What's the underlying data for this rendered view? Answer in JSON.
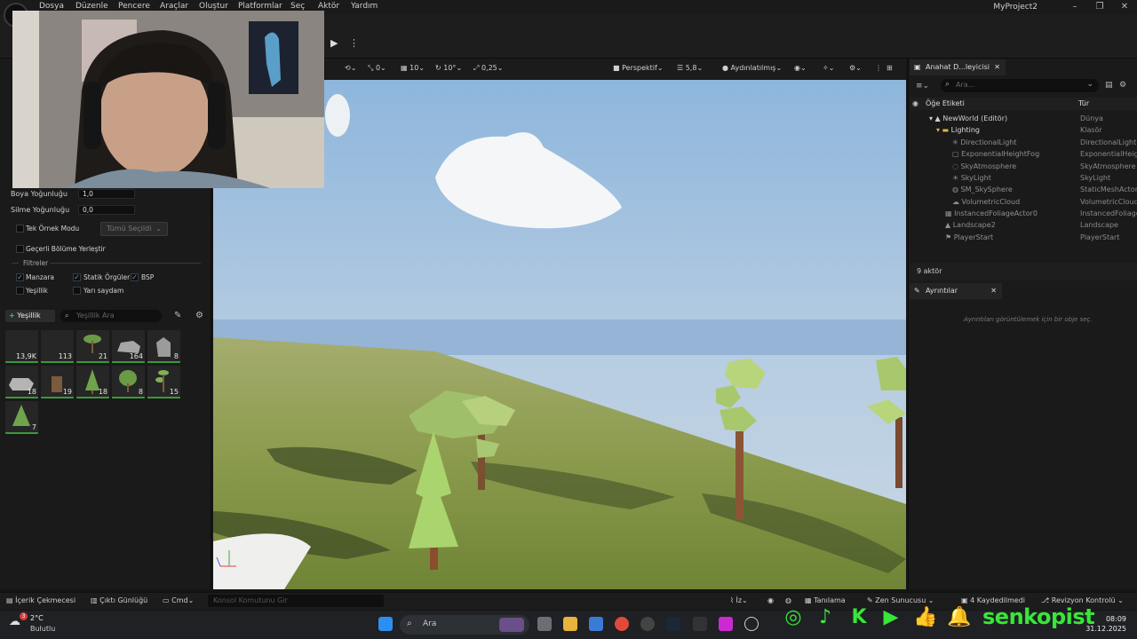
{
  "menubar": {
    "items": [
      "Dosya",
      "Düzenle",
      "Pencere",
      "Araçlar",
      "Oluştur",
      "Platformlar",
      "Seç",
      "Aktör",
      "Yardım"
    ],
    "project_title": "MyProject2"
  },
  "foliage_panel": {
    "paint_density_label": "Boya Yoğunluğu",
    "paint_density_value": "1,0",
    "erase_density_label": "Silme Yoğunluğu",
    "erase_density_value": "0,0",
    "single_instance_label": "Tek Örnek Modu",
    "single_instance_dropdown": "Tümü Seçildi",
    "place_current_level_label": "Geçerli Bölüme Yerleştir",
    "filters_header": "Filtreler",
    "filters": [
      {
        "label": "Manzara",
        "checked": true
      },
      {
        "label": "Statik Örgüler",
        "checked": true
      },
      {
        "label": "BSP",
        "checked": true
      },
      {
        "label": "Yeşillik",
        "checked": false
      },
      {
        "label": "Yarı saydam",
        "checked": false
      }
    ],
    "add_foliage_label": "Yeşillik",
    "search_placeholder": "Yeşillik Ara",
    "tiles": [
      "13,9K",
      "113",
      "21",
      "164",
      "8",
      "18",
      "19",
      "18",
      "8",
      "15",
      "7"
    ]
  },
  "viewport_toolbar": {
    "angle_snap": "0",
    "grid_snap": "10",
    "rotation_snap": "10°",
    "scale_snap": "0,25",
    "view_mode": "Perspektif",
    "camera_speed": "5,8",
    "lighting_mode": "Aydınlatılmış"
  },
  "outliner": {
    "tab_title": "Anahat D...leyicisi",
    "search_placeholder": "Ara...",
    "col_label": "Öğe Etiketi",
    "col_type": "Tür",
    "rows": [
      {
        "name": "NewWorld (Editör)",
        "type": "Dünya"
      },
      {
        "name": "Lighting",
        "type": "Klasör"
      },
      {
        "name": "DirectionalLight",
        "type": "DirectionalLight"
      },
      {
        "name": "ExponentialHeightFog",
        "type": "ExponentialHeig"
      },
      {
        "name": "SkyAtmosphere",
        "type": "SkyAtmosphere"
      },
      {
        "name": "SkyLight",
        "type": "SkyLight"
      },
      {
        "name": "SM_SkySphere",
        "type": "StaticMeshActor"
      },
      {
        "name": "VolumetricCloud",
        "type": "VolumetricCloud"
      },
      {
        "name": "InstancedFoliageActor0",
        "type": "InstancedFoliage"
      },
      {
        "name": "Landscape2",
        "type": "Landscape"
      },
      {
        "name": "PlayerStart",
        "type": "PlayerStart"
      }
    ],
    "actor_count": "9 aktör"
  },
  "details": {
    "tab_title": "Ayrıntılar",
    "empty_text": "Ayrıntıları görüntülemek için bir obje seç."
  },
  "statusbar": {
    "content_drawer": "İçerik Çekmecesi",
    "output_log": "Çıktı Günlüğü",
    "cmd": "Cmd",
    "console_placeholder": "Konsol Komutunu Gir",
    "trace": "İz",
    "derived": "Tanılama",
    "zen": "Zen Sunucusu",
    "saved": "4 Kaydedilmedi",
    "revision": "Revizyon Kontrolü"
  },
  "taskbar": {
    "weather_temp": "2°C",
    "weather_text": "Bulutlu",
    "weather_badge": "3",
    "search_label": "Ara",
    "time": "08:09",
    "date": "31.12.2025"
  },
  "overlay": {
    "brand": "senkopist"
  }
}
